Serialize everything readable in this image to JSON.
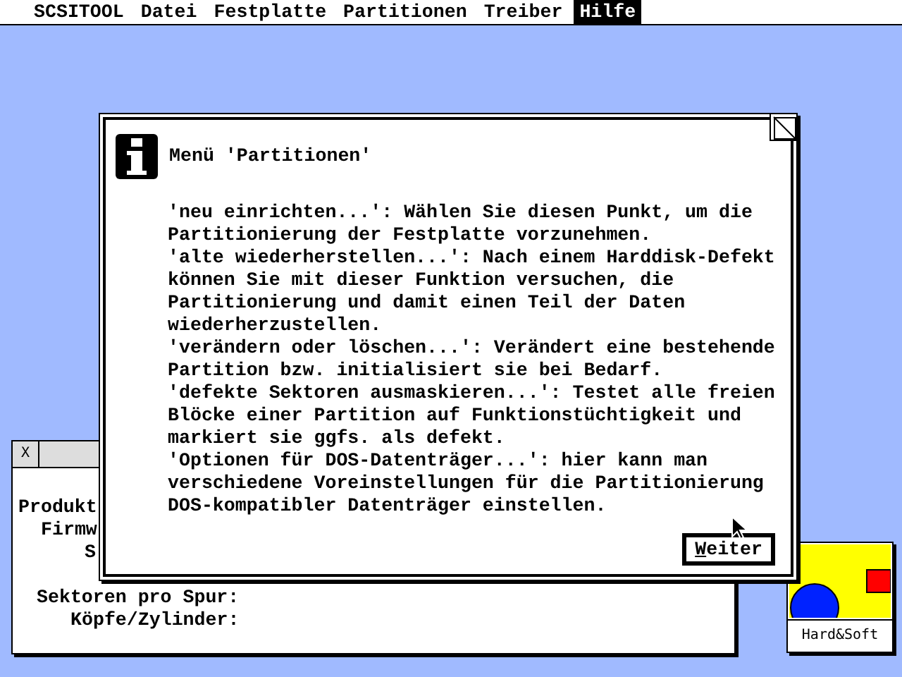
{
  "menu_bar": [
    {
      "label": "SCSITOOL",
      "selected": false
    },
    {
      "label": "Datei",
      "selected": false
    },
    {
      "label": "Festplatte",
      "selected": false
    },
    {
      "label": "Partitionen",
      "selected": false
    },
    {
      "label": "Treiber",
      "selected": false
    },
    {
      "label": "Hilfe",
      "selected": true
    }
  ],
  "background_window": {
    "close_box": "X",
    "labels": [
      "Produkt",
      "Firmw",
      "S",
      "Sektoren pro Spur:",
      "Köpfe/Zylinder:"
    ]
  },
  "dialog": {
    "title": "Menü 'Partitionen'",
    "lines": [
      "'neu einrichten...': Wählen Sie diesen Punkt, um die",
      "Partitionierung der Festplatte vorzunehmen.",
      "'alte wiederherstellen...': Nach einem Harddisk-Defekt",
      "können Sie mit dieser Funktion versuchen, die",
      "Partitionierung und damit einen Teil der Daten",
      "wiederherzustellen.",
      "'verändern oder löschen...': Verändert eine bestehende",
      "Partition bzw. initialisiert sie bei Bedarf.",
      "'defekte Sektoren ausmaskieren...': Testet alle freien",
      "Blöcke einer Partition auf Funktionstüchtigkeit und",
      "markiert sie ggfs. als defekt.",
      "'Optionen für DOS-Datenträger...': hier kann man",
      "verschiedene Voreinstellungen für die Partitionierung",
      "DOS-kompatibler Datenträger einstellen."
    ],
    "button": {
      "label": "Weiter"
    }
  },
  "desktop_icon": {
    "label": "Hard&Soft"
  }
}
